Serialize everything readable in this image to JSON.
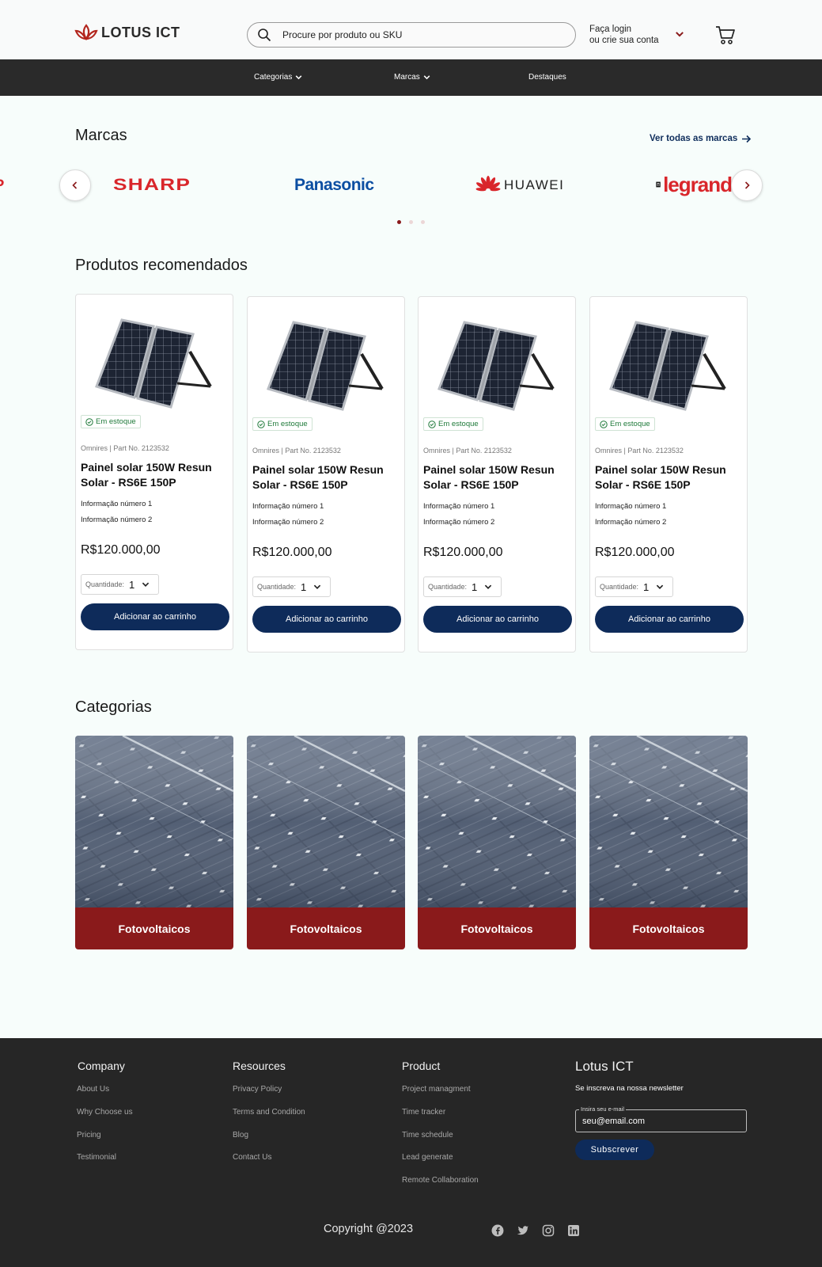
{
  "header": {
    "logo_text": "LOTUS ICT",
    "search_placeholder": "Procure por produto ou SKU",
    "login_line1": "Faça login",
    "login_line2": "ou crie sua conta"
  },
  "nav": {
    "items": [
      {
        "label": "Categorias",
        "has_dropdown": true
      },
      {
        "label": "Marcas",
        "has_dropdown": true
      },
      {
        "label": "Destaques",
        "has_dropdown": false
      }
    ]
  },
  "brands": {
    "title": "Marcas",
    "see_all": "Ver todas as marcas",
    "logos": [
      "SHARP",
      "Panasonic",
      "HUAWEI",
      "legrand"
    ],
    "active_page": 1,
    "pages": 3
  },
  "products": {
    "title": "Produtos recomendados",
    "items": [
      {
        "stock": "Em estoque",
        "part": "Omnires | Part No. 2123532",
        "name": "Painel solar 150W Resun Solar - RS6E 150P",
        "info1": "Informação número 1",
        "info2": "Informação número 2",
        "price": "R$120.000,00",
        "qty_label": "Quantidade:",
        "qty": "1",
        "button": "Adicionar ao carrinho"
      },
      {
        "stock": "Em estoque",
        "part": "Omnires | Part No. 2123532",
        "name": "Painel solar 150W Resun Solar - RS6E 150P",
        "info1": "Informação número 1",
        "info2": "Informação número 2",
        "price": "R$120.000,00",
        "qty_label": "Quantidade:",
        "qty": "1",
        "button": "Adicionar ao carrinho"
      },
      {
        "stock": "Em estoque",
        "part": "Omnires | Part No. 2123532",
        "name": "Painel solar 150W Resun Solar - RS6E 150P",
        "info1": "Informação número 1",
        "info2": "Informação número 2",
        "price": "R$120.000,00",
        "qty_label": "Quantidade:",
        "qty": "1",
        "button": "Adicionar ao carrinho"
      },
      {
        "stock": "Em estoque",
        "part": "Omnires | Part No. 2123532",
        "name": "Painel solar 150W Resun Solar - RS6E 150P",
        "info1": "Informação número 1",
        "info2": "Informação número 2",
        "price": "R$120.000,00",
        "qty_label": "Quantidade:",
        "qty": "1",
        "button": "Adicionar ao carrinho"
      }
    ]
  },
  "categories": {
    "title": "Categorias",
    "items": [
      {
        "label": "Fotovoltaicos"
      },
      {
        "label": "Fotovoltaicos"
      },
      {
        "label": "Fotovoltaicos"
      },
      {
        "label": "Fotovoltaicos"
      }
    ]
  },
  "footer": {
    "company": {
      "title": "Company",
      "links": [
        "About Us",
        "Why Choose us",
        "Pricing",
        "Testimonial"
      ]
    },
    "resources": {
      "title": "Resources",
      "links": [
        "Privacy Policy",
        "Terms and Condition",
        "Blog",
        "Contact Us"
      ]
    },
    "product": {
      "title": "Product",
      "links": [
        "Project managment",
        "Time tracker",
        "Time schedule",
        "Lead generate",
        "Remote Collaboration"
      ]
    },
    "newsletter": {
      "title": "Lotus ICT",
      "subtitle": "Se inscreva na nossa newsletter",
      "email_label": "Insira seu e-mail",
      "email_value": "seu@email.com",
      "button": "Subscrever"
    },
    "copyright": "Copyright @2023",
    "social": [
      "facebook-icon",
      "twitter-icon",
      "instagram-icon",
      "linkedin-icon"
    ]
  },
  "colors": {
    "brand_red": "#8a1a1b",
    "navy": "#0e2b5a",
    "dark_bar": "#2a2a2a",
    "footer_bg": "#262626",
    "stock_green": "#1f7a3a"
  }
}
